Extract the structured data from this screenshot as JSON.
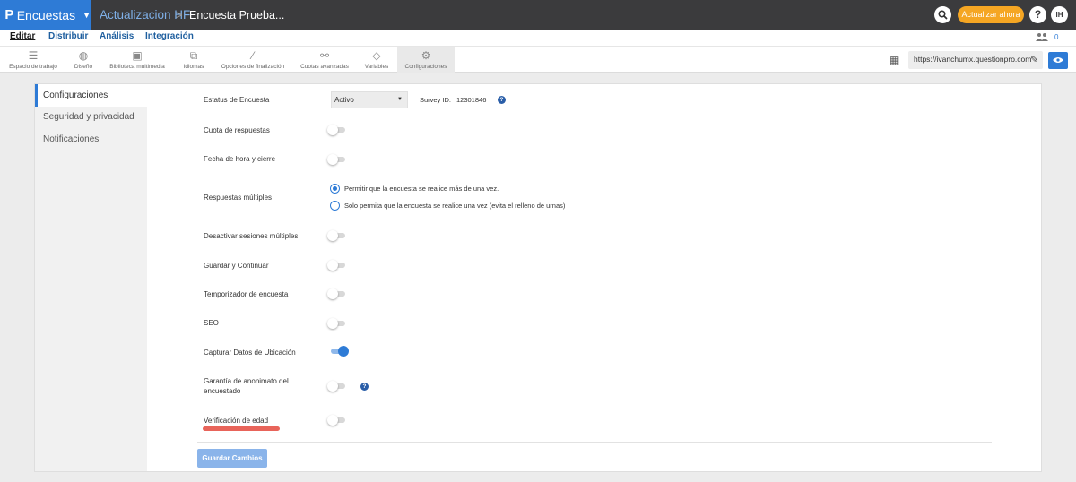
{
  "app": {
    "logo": "P",
    "name": "Encuestas"
  },
  "breadcrumb": {
    "project": "Actualizacion HF",
    "separator": ">",
    "survey": "Encuesta Prueba..."
  },
  "topbar": {
    "upgrade_label": "Actualizar ahora",
    "help_label": "?",
    "avatar_initials": "IH"
  },
  "menu": {
    "items": [
      {
        "label": "Editar",
        "active": true
      },
      {
        "label": "Distribuir",
        "active": false
      },
      {
        "label": "Análisis",
        "active": false
      },
      {
        "label": "Integración",
        "active": false
      }
    ],
    "collaborators_count": "0"
  },
  "toolbar": {
    "items": [
      {
        "label": "Espacio de trabajo",
        "icon": "list-icon"
      },
      {
        "label": "Diseño",
        "icon": "palette-icon"
      },
      {
        "label": "Biblioteca multimedia",
        "icon": "image-icon"
      },
      {
        "label": "Idiomas",
        "icon": "translate-icon"
      },
      {
        "label": "Opciones de finalización",
        "icon": "wand-icon"
      },
      {
        "label": "Cuotas avanzadas",
        "icon": "link-icon"
      },
      {
        "label": "Variables",
        "icon": "tag-icon"
      },
      {
        "label": "Configuraciones",
        "icon": "gear-icon",
        "active": true
      }
    ],
    "survey_url": "https://ivanchumx.questionpro.com"
  },
  "sidebar": {
    "items": [
      {
        "label": "Configuraciones",
        "active": true
      },
      {
        "label": "Seguridad y privacidad",
        "active": false
      },
      {
        "label": "Notificaciones",
        "active": false
      }
    ]
  },
  "settings": {
    "status": {
      "label": "Estatus de Encuesta",
      "value": "Activo",
      "survey_id_label": "Survey ID:",
      "survey_id": "12301846"
    },
    "quota": {
      "label": "Cuota de respuestas",
      "on": false
    },
    "close_date": {
      "label": "Fecha de hora y cierre",
      "on": false
    },
    "multiple_responses": {
      "label": "Respuestas múltiples",
      "options": [
        {
          "label": "Permitir que la encuesta se realice más de una vez.",
          "selected": true
        },
        {
          "label": "Solo permita que la encuesta se realice una vez (evita el relleno de urnas)",
          "selected": false
        }
      ]
    },
    "disable_multi_sessions": {
      "label": "Desactivar sesiones múltiples",
      "on": false
    },
    "save_continue": {
      "label": "Guardar y Continuar",
      "on": false
    },
    "timer": {
      "label": "Temporizador de encuesta",
      "on": false
    },
    "seo": {
      "label": "SEO",
      "on": false
    },
    "location": {
      "label": "Capturar Datos de Ubicación",
      "on": true
    },
    "anonymity": {
      "label_line1": "Garantía de anonimato del",
      "label_line2": "encuestado",
      "on": false
    },
    "age_verification": {
      "label": "Verificación de edad",
      "on": false
    }
  },
  "save_label": "Guardar Cambios",
  "colors": {
    "brand_blue": "#2e7bd6",
    "topbar_dark": "#3b3b3d",
    "upgrade_orange": "#f5a623",
    "highlight_red": "#e8645a"
  }
}
